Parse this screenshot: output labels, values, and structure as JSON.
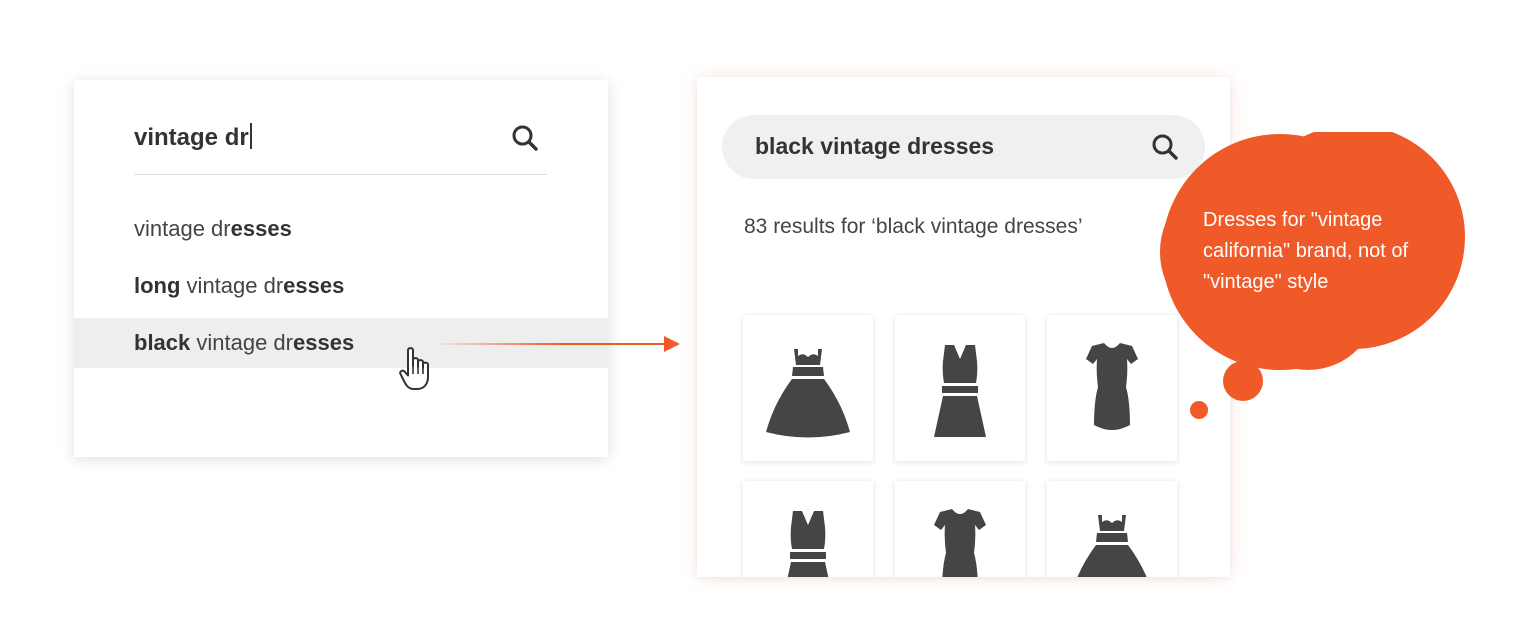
{
  "left_panel": {
    "typed_query": "vintage dr",
    "search_icon": "search-icon",
    "suggestions": [
      {
        "prefix": "",
        "mid": "vintage dr",
        "suffix": "esses"
      },
      {
        "prefix": "long",
        "mid": " vintage dr",
        "suffix": "esses"
      },
      {
        "prefix": "black",
        "mid": " vintage dr",
        "suffix": "esses",
        "highlighted": true
      }
    ],
    "cursor_icon": "pointer-hand-icon"
  },
  "right_panel": {
    "query": "black vintage dresses",
    "search_icon": "search-icon",
    "results_text": "83 results for ‘black vintage dresses’",
    "products": [
      {
        "icon": "dress-sweetheart-flare-icon"
      },
      {
        "icon": "dress-vneck-belted-icon"
      },
      {
        "icon": "dress-bodycon-icon"
      },
      {
        "icon": "dress-vneck-belted-icon"
      },
      {
        "icon": "dress-bodycon-icon"
      },
      {
        "icon": "dress-sweetheart-flare-icon"
      }
    ]
  },
  "thought_bubble": {
    "text": "Dresses for \"vintage california\" brand, not of \"vintage\" style"
  },
  "colors": {
    "accent": "#f05a28",
    "text_dark": "#333333",
    "highlight_row": "#eeeeee",
    "pill_bg": "#f0f0f0",
    "dress_fill": "#454545"
  }
}
